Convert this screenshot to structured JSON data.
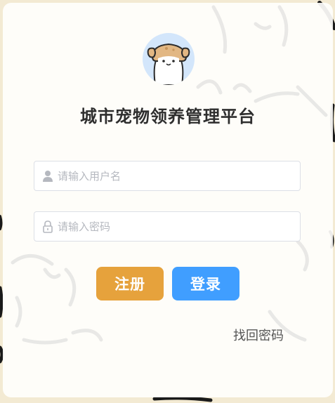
{
  "app": {
    "title": "城市宠物领养管理平台"
  },
  "form": {
    "username_placeholder": "请输入用户名",
    "password_placeholder": "请输入密码",
    "register_label": "注册",
    "login_label": "登录",
    "forgot_label": "找回密码"
  },
  "icons": {
    "user": "user-icon",
    "lock": "lock-icon",
    "logo": "dog-logo-icon"
  },
  "colors": {
    "register_button": "#e6a23c",
    "login_button": "#409eff",
    "page_background": "#f3ead3",
    "avatar_background": "#d3e6fb",
    "title_text": "#2e2e2e"
  }
}
